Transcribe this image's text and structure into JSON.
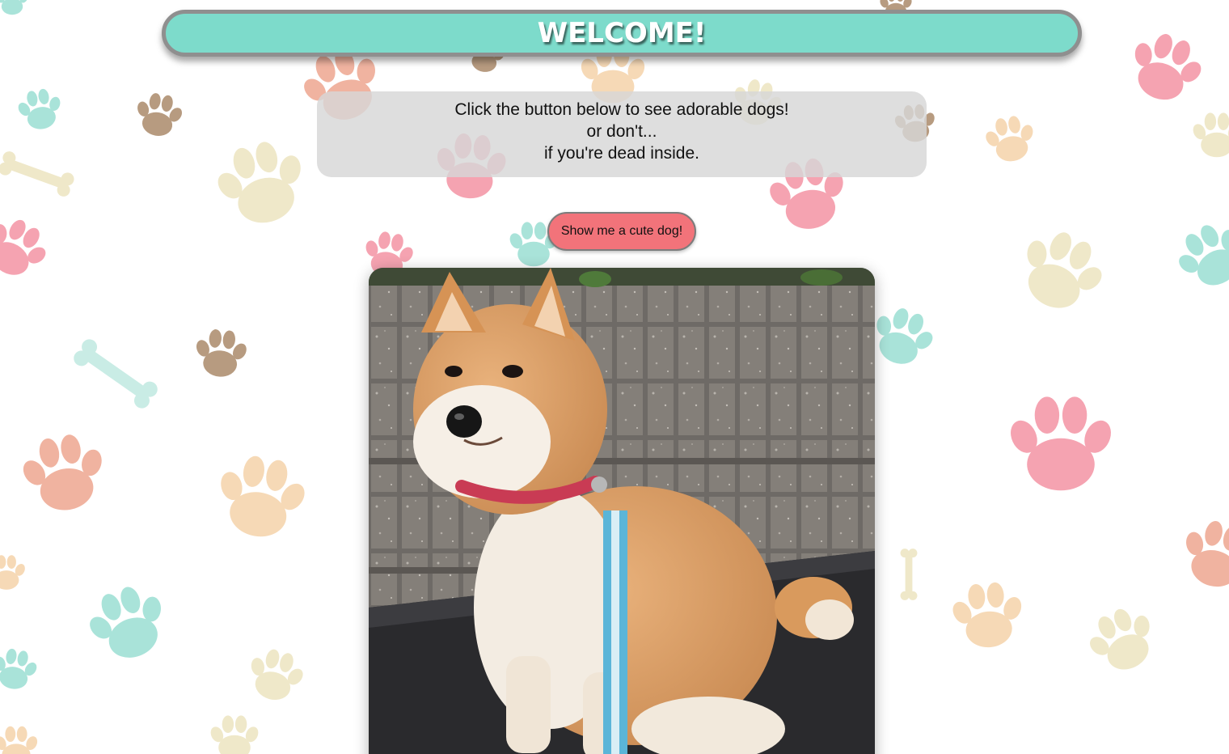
{
  "header": {
    "title": "WELCOME!"
  },
  "intro": {
    "line1": "Click the button below to see adorable dogs!",
    "line2": "or don't...",
    "line3": "if you're dead inside."
  },
  "button": {
    "label": "Show me a cute dog!"
  },
  "photo": {
    "subject": "shiba-inu-dog-photo"
  },
  "colors": {
    "header_bg": "#7ddbcb",
    "header_border": "#8f8f8f",
    "button_bg": "#f2737a",
    "intro_bg": "#d7d7d7",
    "paw_pink": "#f5a3b1",
    "paw_teal": "#a9e3d9",
    "paw_tan": "#b79b80",
    "paw_peach": "#f6d9b6",
    "paw_cream": "#efe8c9",
    "paw_salmon": "#f0b3a0"
  }
}
